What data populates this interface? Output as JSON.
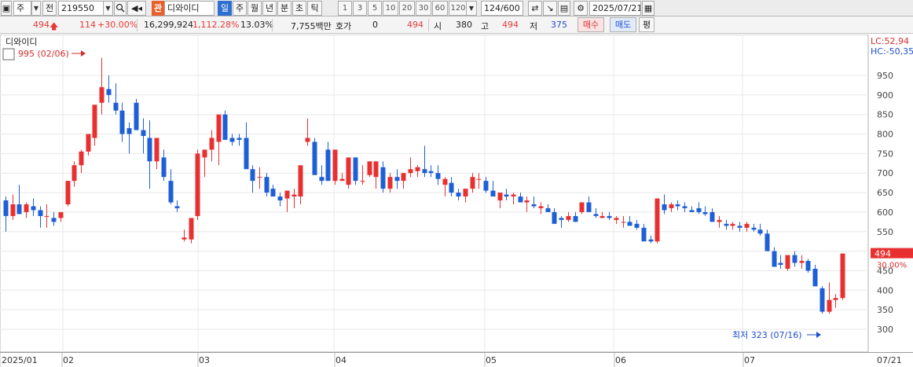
{
  "toolbar": {
    "stock_code": "219550",
    "stock_name": "디와이디",
    "badge": "관",
    "prefix_label": "전",
    "period_selected": "일",
    "periods": [
      "주",
      "월",
      "년",
      "분",
      "초",
      "틱"
    ],
    "minute_buttons": [
      "1",
      "3",
      "5",
      "10",
      "20",
      "30",
      "60",
      "120"
    ],
    "data_count": "124/600",
    "date": "2025/07/21",
    "type_label": "주"
  },
  "info": {
    "price": "494",
    "change": "114",
    "change_pct": "+30.00%",
    "volume": "16,299,924",
    "volume_ratio": "1,112.28%",
    "turnover": "13.03%",
    "amount": "7,755백만",
    "quote_label": "호가",
    "quote_value": "0",
    "quote_price": "494",
    "open_label": "시",
    "open": "380",
    "high_label": "고",
    "high": "494",
    "low_label": "저",
    "low": "375",
    "buy_label": "매수",
    "sell_label": "매도",
    "eq_label": "평"
  },
  "chart": {
    "title": "디와이디",
    "lc_label": "LC:52,94",
    "hc_label": "HC:-50,35",
    "max_annotation": "995 (02/06)",
    "min_annotation": "최저 323 (07/16)",
    "current_price_tag": "494",
    "current_pct_tag": "30.00%",
    "colors": {
      "up": "#e83030",
      "down": "#1f5fd6",
      "grid": "#e8e8e8"
    }
  },
  "chart_data": {
    "type": "candlestick",
    "y_ticks": [
      300,
      350,
      400,
      450,
      500,
      550,
      600,
      650,
      700,
      750,
      800,
      850,
      900,
      950
    ],
    "ylim": [
      290,
      1010
    ],
    "x_labels": [
      "2025/01",
      "02",
      "03",
      "04",
      "05",
      "06",
      "07",
      "07/21"
    ],
    "candles": [
      [
        630,
        640,
        550,
        590
      ],
      [
        590,
        645,
        580,
        620
      ],
      [
        620,
        670,
        600,
        595
      ],
      [
        600,
        625,
        585,
        620
      ],
      [
        615,
        635,
        590,
        605
      ],
      [
        605,
        615,
        560,
        590
      ],
      [
        590,
        620,
        560,
        590
      ],
      [
        585,
        600,
        565,
        575
      ],
      [
        585,
        600,
        575,
        600
      ],
      [
        620,
        680,
        615,
        680
      ],
      [
        680,
        730,
        665,
        720
      ],
      [
        720,
        760,
        700,
        755
      ],
      [
        755,
        790,
        745,
        800
      ],
      [
        790,
        870,
        770,
        875
      ],
      [
        880,
        995,
        850,
        920
      ],
      [
        915,
        950,
        880,
        900
      ],
      [
        880,
        930,
        850,
        860
      ],
      [
        860,
        880,
        780,
        800
      ],
      [
        815,
        830,
        750,
        800
      ],
      [
        880,
        890,
        810,
        810
      ],
      [
        810,
        840,
        750,
        795
      ],
      [
        790,
        835,
        660,
        730
      ],
      [
        730,
        790,
        710,
        790
      ],
      [
        740,
        760,
        680,
        690
      ],
      [
        680,
        710,
        620,
        625
      ],
      [
        615,
        630,
        600,
        610
      ],
      [
        530,
        555,
        525,
        535
      ],
      [
        530,
        560,
        520,
        585
      ],
      [
        590,
        760,
        580,
        750
      ],
      [
        740,
        760,
        690,
        760
      ],
      [
        760,
        810,
        730,
        790
      ],
      [
        780,
        840,
        720,
        850
      ],
      [
        850,
        860,
        800,
        785
      ],
      [
        790,
        800,
        770,
        780
      ],
      [
        790,
        800,
        770,
        785
      ],
      [
        790,
        830,
        770,
        710
      ],
      [
        710,
        720,
        650,
        680
      ],
      [
        690,
        715,
        660,
        690
      ],
      [
        690,
        700,
        640,
        650
      ],
      [
        660,
        670,
        640,
        640
      ],
      [
        640,
        650,
        615,
        630
      ],
      [
        635,
        650,
        600,
        655
      ],
      [
        640,
        660,
        610,
        645
      ],
      [
        640,
        680,
        620,
        720
      ],
      [
        780,
        840,
        770,
        790
      ],
      [
        780,
        790,
        760,
        695
      ],
      [
        690,
        720,
        670,
        680
      ],
      [
        760,
        780,
        690,
        680
      ],
      [
        680,
        760,
        670,
        760
      ],
      [
        680,
        700,
        680,
        685
      ],
      [
        670,
        700,
        660,
        740
      ],
      [
        740,
        740,
        670,
        680
      ],
      [
        680,
        720,
        670,
        680
      ],
      [
        695,
        710,
        690,
        730
      ],
      [
        690,
        720,
        660,
        730
      ],
      [
        715,
        730,
        650,
        660
      ],
      [
        660,
        700,
        650,
        690
      ],
      [
        690,
        710,
        660,
        680
      ],
      [
        680,
        690,
        660,
        700
      ],
      [
        700,
        740,
        690,
        710
      ],
      [
        705,
        720,
        690,
        715
      ],
      [
        710,
        770,
        690,
        700
      ],
      [
        705,
        720,
        690,
        700
      ],
      [
        700,
        720,
        670,
        685
      ],
      [
        670,
        690,
        640,
        685
      ],
      [
        675,
        690,
        640,
        650
      ],
      [
        650,
        660,
        630,
        640
      ],
      [
        640,
        650,
        625,
        660
      ],
      [
        660,
        700,
        650,
        690
      ],
      [
        685,
        700,
        660,
        685
      ],
      [
        680,
        690,
        650,
        655
      ],
      [
        655,
        680,
        640,
        640
      ],
      [
        630,
        640,
        610,
        650
      ],
      [
        645,
        660,
        630,
        640
      ],
      [
        640,
        650,
        620,
        645
      ],
      [
        640,
        650,
        625,
        625
      ],
      [
        625,
        640,
        600,
        630
      ],
      [
        620,
        640,
        610,
        615
      ],
      [
        610,
        625,
        595,
        615
      ],
      [
        610,
        620,
        600,
        600
      ],
      [
        600,
        610,
        580,
        570
      ],
      [
        585,
        590,
        560,
        580
      ],
      [
        580,
        600,
        575,
        590
      ],
      [
        590,
        600,
        575,
        575
      ],
      [
        600,
        625,
        595,
        625
      ],
      [
        625,
        640,
        605,
        600
      ],
      [
        595,
        610,
        585,
        590
      ],
      [
        585,
        600,
        585,
        590
      ],
      [
        590,
        600,
        580,
        585
      ],
      [
        580,
        590,
        570,
        585
      ],
      [
        575,
        590,
        560,
        575
      ],
      [
        575,
        590,
        570,
        565
      ],
      [
        570,
        580,
        555,
        560
      ],
      [
        560,
        570,
        545,
        525
      ],
      [
        530,
        540,
        520,
        525
      ],
      [
        525,
        535,
        520,
        635
      ],
      [
        620,
        645,
        595,
        605
      ],
      [
        610,
        625,
        600,
        620
      ],
      [
        620,
        630,
        605,
        615
      ],
      [
        615,
        625,
        600,
        610
      ],
      [
        605,
        615,
        600,
        600
      ],
      [
        610,
        625,
        595,
        600
      ],
      [
        600,
        615,
        590,
        595
      ],
      [
        600,
        610,
        580,
        575
      ],
      [
        575,
        590,
        560,
        580
      ],
      [
        570,
        580,
        555,
        565
      ],
      [
        565,
        575,
        555,
        570
      ],
      [
        565,
        575,
        550,
        560
      ],
      [
        560,
        575,
        550,
        570
      ],
      [
        560,
        570,
        550,
        555
      ],
      [
        555,
        570,
        540,
        545
      ],
      [
        545,
        555,
        520,
        500
      ],
      [
        500,
        510,
        460,
        460
      ],
      [
        470,
        490,
        455,
        465
      ],
      [
        455,
        485,
        450,
        490
      ],
      [
        490,
        500,
        460,
        470
      ],
      [
        470,
        490,
        455,
        475
      ],
      [
        475,
        480,
        445,
        450
      ],
      [
        455,
        465,
        410,
        410
      ],
      [
        405,
        410,
        340,
        345
      ],
      [
        345,
        420,
        340,
        375
      ],
      [
        375,
        390,
        355,
        380
      ],
      [
        380,
        494,
        375,
        494
      ]
    ]
  }
}
